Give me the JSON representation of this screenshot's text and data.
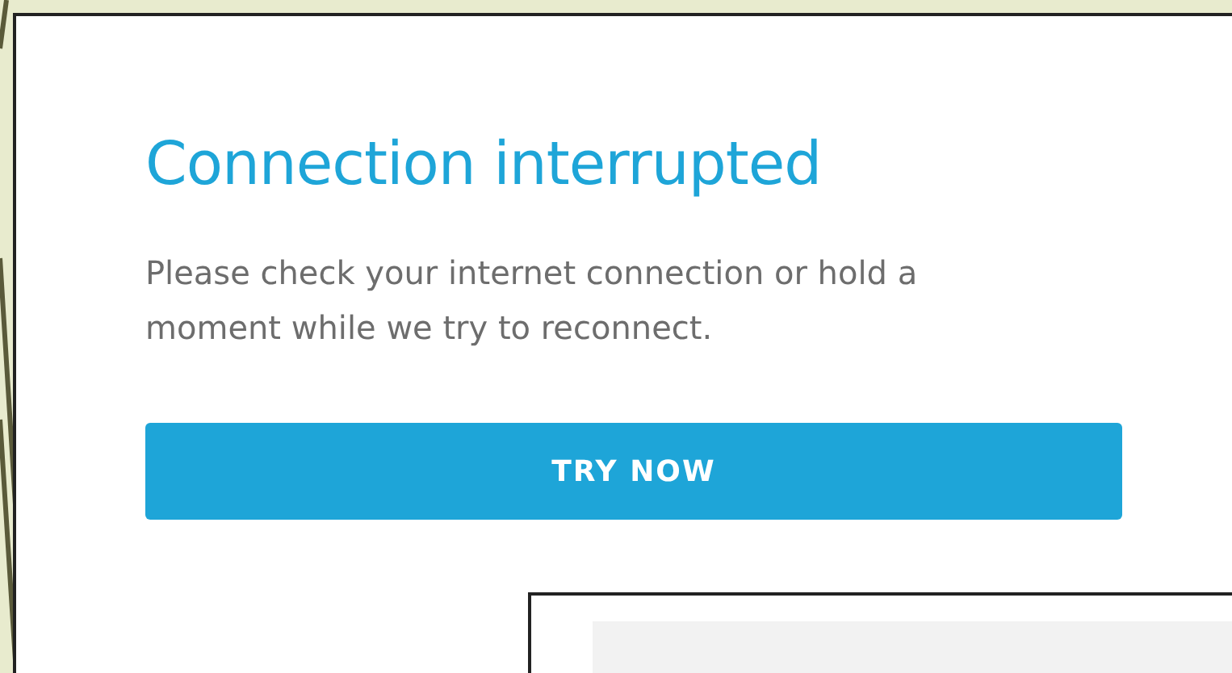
{
  "dialog": {
    "title": "Connection interrupted",
    "message": "Please check your internet connection or hold a moment while we try to reconnect.",
    "button": {
      "label": "TRY NOW"
    }
  }
}
